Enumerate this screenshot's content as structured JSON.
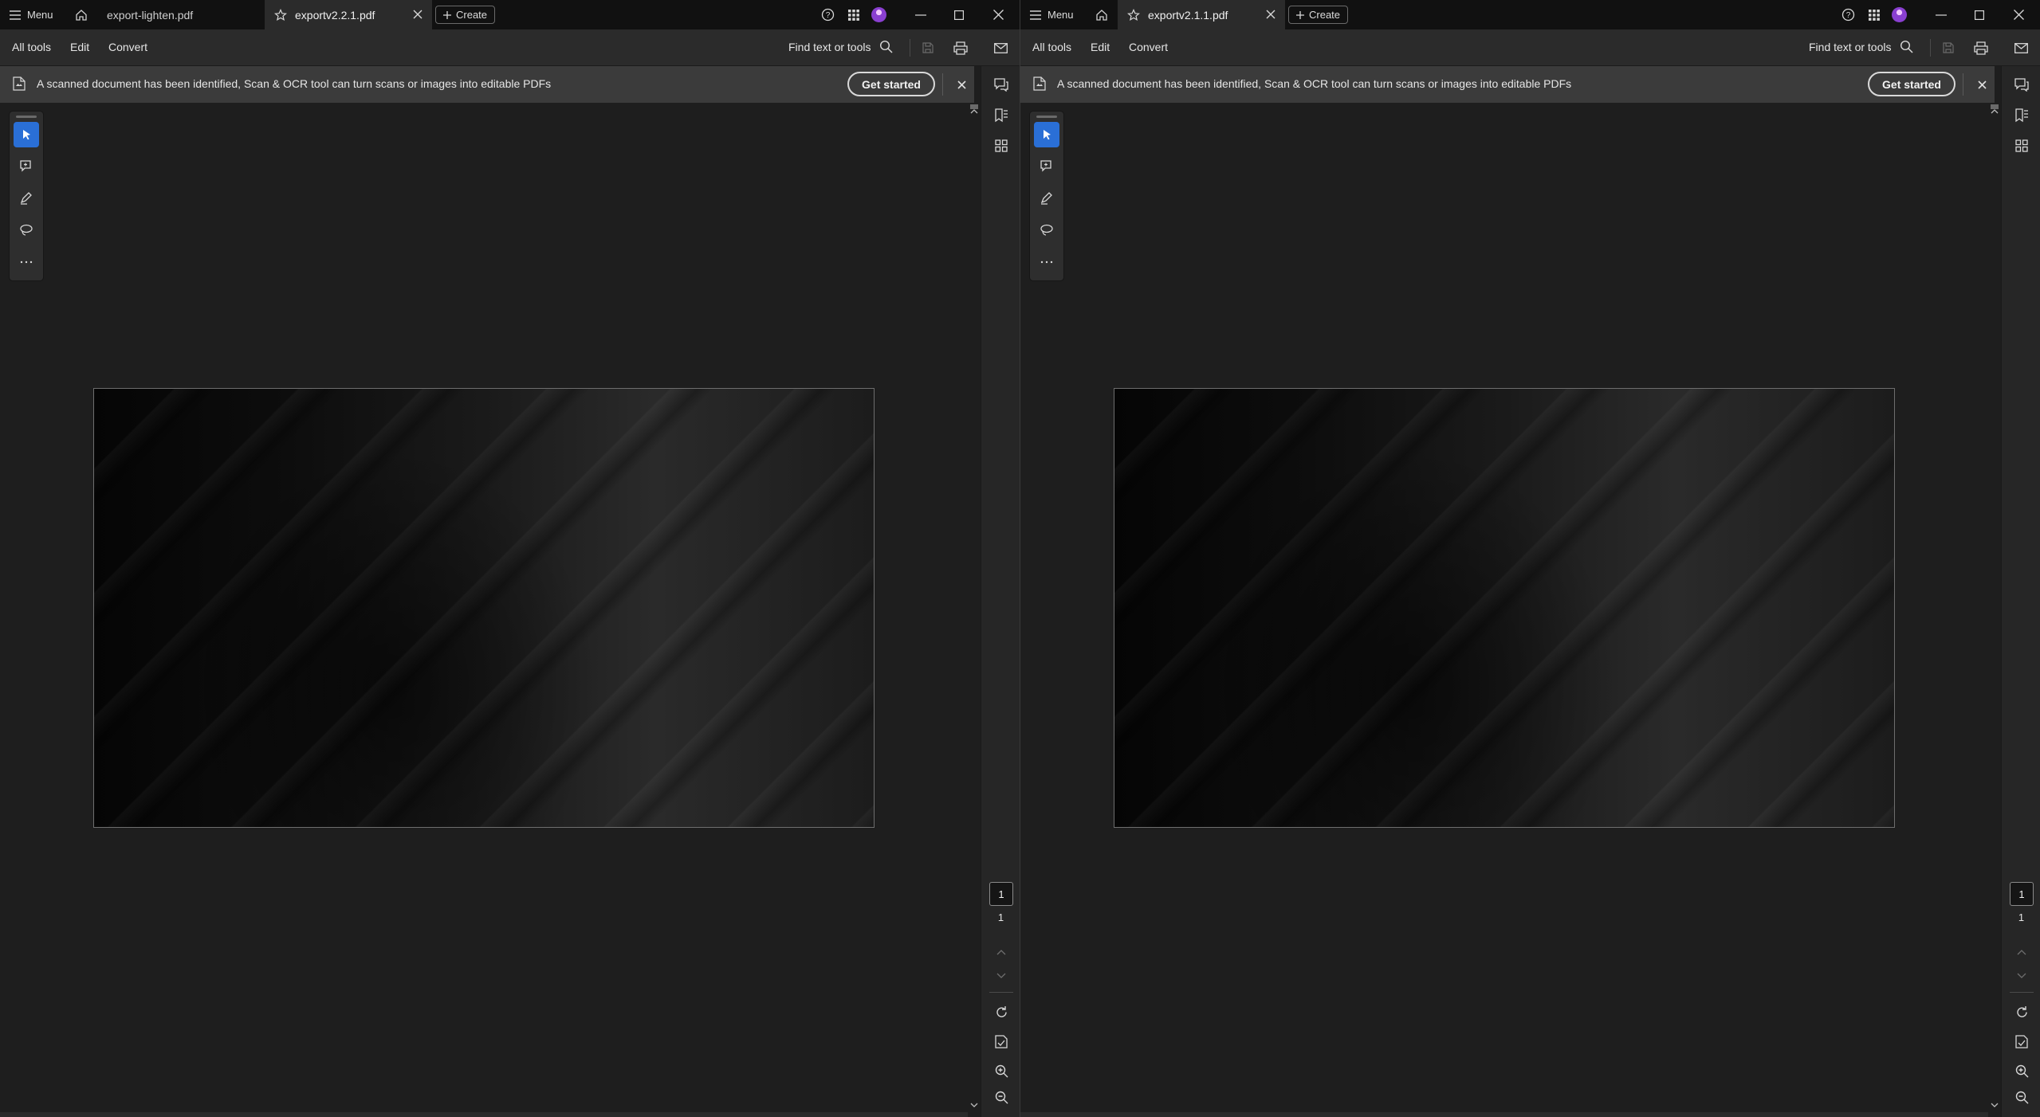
{
  "windows": [
    {
      "menu_label": "Menu",
      "tabs": [
        {
          "label": "export-lighten.pdf",
          "active": false
        },
        {
          "label": "exportv2.2.1.pdf",
          "active": true
        }
      ],
      "create_label": "Create",
      "toolbar": {
        "all_tools": "All tools",
        "edit": "Edit",
        "convert": "Convert",
        "find": "Find text or tools"
      },
      "banner": {
        "message": "A scanned document has been identified, Scan & OCR tool can turn scans or images into editable PDFs",
        "action": "Get started"
      },
      "page": {
        "current": "1",
        "total": "1"
      }
    },
    {
      "menu_label": "Menu",
      "tabs": [
        {
          "label": "exportv2.1.1.pdf",
          "active": true
        }
      ],
      "create_label": "Create",
      "toolbar": {
        "all_tools": "All tools",
        "edit": "Edit",
        "convert": "Convert",
        "find": "Find text or tools"
      },
      "banner": {
        "message": "A scanned document has been identified, Scan & OCR tool can turn scans or images into editable PDFs",
        "action": "Get started"
      },
      "page": {
        "current": "1",
        "total": "1"
      }
    }
  ],
  "colors": {
    "accent": "#2a6fd6",
    "titlebar": "#111111",
    "toolbar": "#2b2b2b",
    "banner": "#3b3b3b",
    "canvas": "#1e1e1e"
  },
  "icons": [
    "menu-icon",
    "home-icon",
    "star-icon",
    "close-icon",
    "plus-icon",
    "help-icon",
    "apps-grid-icon",
    "avatar",
    "minimize-icon",
    "maximize-icon",
    "search-icon",
    "save-icon",
    "print-icon",
    "email-icon",
    "document-icon",
    "comment-icon",
    "bookmark-icon",
    "thumbnails-icon",
    "select-arrow-icon",
    "add-comment-icon",
    "highlight-pen-icon",
    "lasso-icon",
    "more-icon",
    "chevron-up-icon",
    "chevron-down-icon",
    "rotate-icon",
    "extract-page-icon",
    "zoom-in-icon",
    "zoom-out-icon"
  ]
}
